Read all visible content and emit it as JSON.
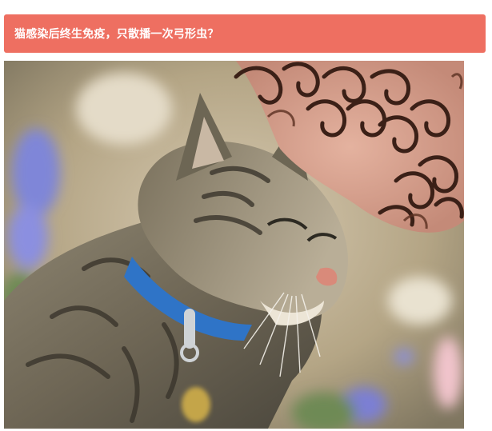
{
  "article": {
    "title": "猫感染后终生免疫，只散播一次弓形虫？"
  },
  "photo": {
    "subject": "cat-and-child-photo"
  },
  "colors": {
    "header_bg": "#ee6f61",
    "header_text": "#ffffff",
    "page_bg": "#ffffff"
  }
}
